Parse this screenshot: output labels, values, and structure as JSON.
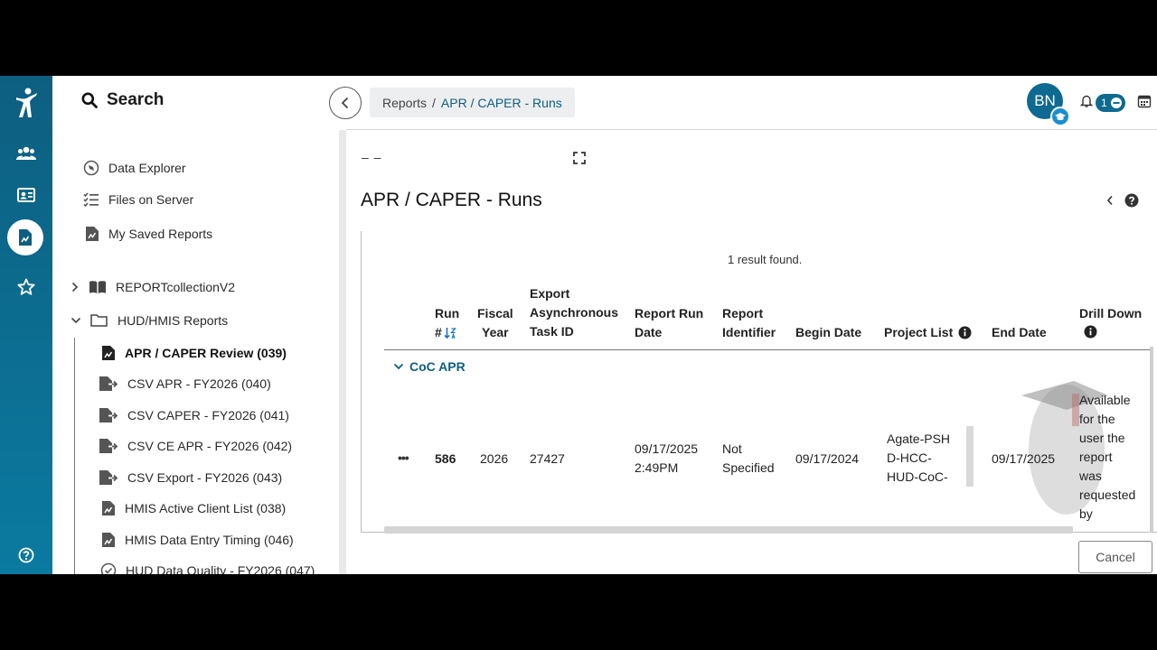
{
  "topbar": {
    "breadcrumb_root": "Reports",
    "breadcrumb_sep": "/",
    "breadcrumb_current": "APR / CAPER - Runs",
    "avatar_initials": "BN",
    "notification_count": "1"
  },
  "nav": {
    "search_label": "Search",
    "items": [
      {
        "label": "Data Explorer"
      },
      {
        "label": "Files on Server"
      },
      {
        "label": "My Saved Reports"
      }
    ],
    "folders": [
      {
        "label": "REPORTcollectionV2"
      },
      {
        "label": "HUD/HMIS Reports"
      }
    ],
    "reports": [
      {
        "label": "APR / CAPER Review (039)"
      },
      {
        "label": "CSV APR - FY2026 (040)"
      },
      {
        "label": "CSV CAPER - FY2026 (041)"
      },
      {
        "label": "CSV CE APR - FY2026 (042)"
      },
      {
        "label": "CSV Export - FY2026 (043)"
      },
      {
        "label": "HMIS Active Client List (038)"
      },
      {
        "label": "HMIS Data Entry Timing (046)"
      },
      {
        "label": "HUD Data Quality - FY2026 (047)"
      }
    ]
  },
  "main": {
    "mini_dash": "– –",
    "title": "APR / CAPER - Runs",
    "result_count": "1 result found.",
    "columns": {
      "run": [
        "Run",
        "#"
      ],
      "fiscal_year": [
        "Fiscal",
        "Year"
      ],
      "export_task": [
        "Export",
        "Asynchronous",
        "Task ID"
      ],
      "run_date": [
        "Report Run",
        "Date"
      ],
      "identifier": [
        "Report",
        "Identifier"
      ],
      "begin_date": "Begin Date",
      "project_list": "Project List",
      "end_date": "End Date",
      "drill_down": "Drill Down"
    },
    "group_label": "CoC APR",
    "row": {
      "actions": "•••",
      "run": "586",
      "fiscal_year": "2026",
      "task_id": "27427",
      "run_date": [
        "09/17/2025",
        "2:49PM"
      ],
      "identifier": [
        "Not",
        "Specified"
      ],
      "begin_date": "09/17/2024",
      "project_list": [
        "Agate-PSH",
        "D-HCC-",
        "HUD-CoC-"
      ],
      "end_date": "09/17/2025",
      "drill_down": [
        "Available",
        "for the",
        "user the",
        "report",
        "was",
        "requested",
        "by"
      ]
    },
    "cancel_label": "Cancel"
  },
  "colors": {
    "rail": "#0b6d90",
    "accent": "#0e5f80",
    "sort_icon": "#1a73c9"
  }
}
